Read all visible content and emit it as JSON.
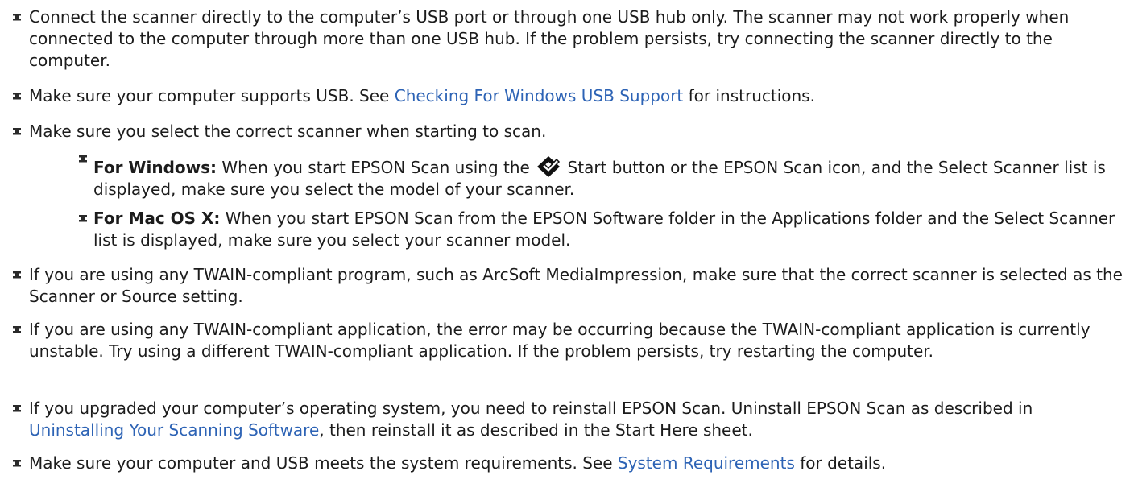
{
  "items": [
    {
      "text": "Connect the scanner directly to the computer’s USB port or through one USB hub only. The scanner may not work properly when connected to the computer through more than one USB hub. If the problem persists, try connecting the scanner directly to the computer."
    },
    {
      "before": "Make sure your computer supports USB. See ",
      "link": "Checking For Windows USB Support",
      "after": " for instructions."
    },
    {
      "text": "Make sure you select the correct scanner when starting to scan."
    },
    {
      "bold": "For Windows:",
      "before_icon": " When you start EPSON Scan using the ",
      "icon": "epson-start-button-icon",
      "after_icon": " Start button or the EPSON Scan icon, and the Select Scanner list is displayed, make sure you select the model of your scanner."
    },
    {
      "bold": "For Mac OS X:",
      "text": " When you start EPSON Scan from the EPSON Software folder in the Applications folder and the Select Scanner list is displayed, make sure you select your scanner model."
    },
    {
      "text": "If you are using any TWAIN-compliant program, such as ArcSoft MediaImpression, make sure that the correct scanner is selected as the Scanner or Source setting."
    },
    {
      "text": "If you are using any TWAIN-compliant application, the error may be occurring because the TWAIN-compliant application is currently unstable. Try using a different TWAIN-compliant application. If the problem persists, try restarting the computer."
    },
    {
      "before": "If you upgraded your computer’s operating system, you need to reinstall EPSON Scan. Uninstall EPSON Scan as described in ",
      "link": "Uninstalling Your Scanning Software",
      "after": ", then reinstall it as described in the Start Here sheet."
    },
    {
      "before": "Make sure your computer and USB meets the system requirements. See ",
      "link": "System Requirements",
      "after": " for details."
    }
  ],
  "colors": {
    "text": "#1c1c1c",
    "link": "#2d63b5",
    "bullet": "#2a2a2a"
  },
  "icons": {
    "bullet": "pushpin-bullet-icon"
  }
}
